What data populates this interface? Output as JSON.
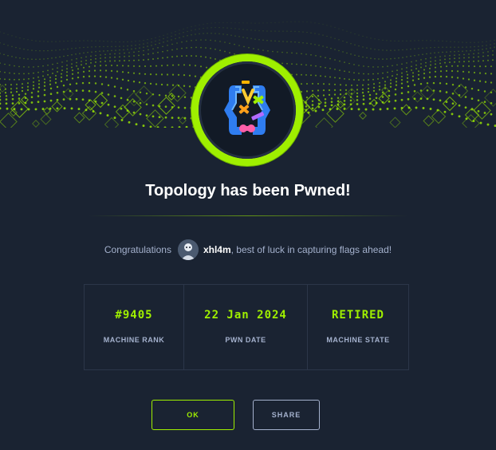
{
  "header": {
    "title": "Topology has been Pwned!"
  },
  "congrats": {
    "prefix": "Congratulations",
    "username": "xhl4m",
    "suffix": ", best of luck in capturing flags ahead!"
  },
  "stats": [
    {
      "value": "#9405",
      "label": "MACHINE RANK"
    },
    {
      "value": "22 Jan 2024",
      "label": "PWN DATE"
    },
    {
      "value": "RETIRED",
      "label": "MACHINE STATE"
    }
  ],
  "actions": {
    "ok_label": "OK",
    "share_label": "SHARE"
  },
  "colors": {
    "accent": "#9fef00",
    "background": "#1a2332",
    "muted_text": "#a4b1cd"
  },
  "icons": {
    "banner": "green-digital-wave",
    "badge": "topology-machine-logo",
    "avatar": "user-avatar"
  }
}
